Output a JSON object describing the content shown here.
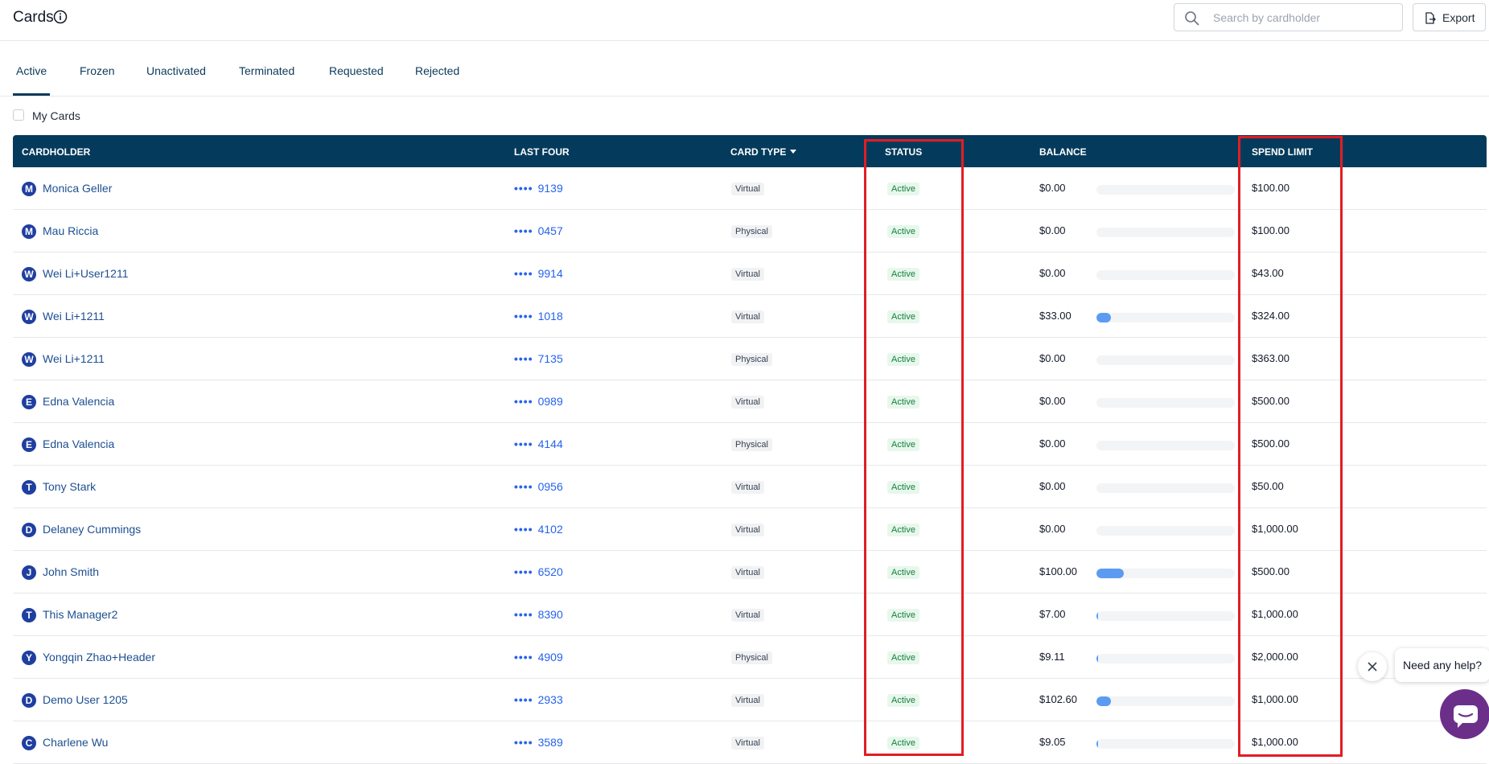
{
  "header": {
    "title": "Cards",
    "search_placeholder": "Search by cardholder",
    "export_label": "Export"
  },
  "tabs": [
    {
      "label": "Active",
      "active": true
    },
    {
      "label": "Frozen"
    },
    {
      "label": "Unactivated"
    },
    {
      "label": "Terminated"
    },
    {
      "label": "Requested"
    },
    {
      "label": "Rejected"
    }
  ],
  "filter": {
    "my_cards_label": "My Cards",
    "my_cards_checked": false
  },
  "table": {
    "columns": {
      "cardholder": "CARDHOLDER",
      "last_four": "LAST FOUR",
      "card_type": "CARD TYPE",
      "status": "STATUS",
      "balance": "BALANCE",
      "spend_limit": "SPEND LIMIT"
    },
    "mask": "••••",
    "rows": [
      {
        "initial": "M",
        "cardholder": "Monica Geller",
        "last_four": "9139",
        "card_type": "Virtual",
        "status": "Active",
        "balance": "$0.00",
        "spend_limit": "$100.00",
        "usage": 0
      },
      {
        "initial": "M",
        "cardholder": "Mau Riccia",
        "last_four": "0457",
        "card_type": "Physical",
        "status": "Active",
        "balance": "$0.00",
        "spend_limit": "$100.00",
        "usage": 0
      },
      {
        "initial": "W",
        "cardholder": "Wei Li+User1211",
        "last_four": "9914",
        "card_type": "Virtual",
        "status": "Active",
        "balance": "$0.00",
        "spend_limit": "$43.00",
        "usage": 0
      },
      {
        "initial": "W",
        "cardholder": "Wei Li+1211",
        "last_four": "1018",
        "card_type": "Virtual",
        "status": "Active",
        "balance": "$33.00",
        "spend_limit": "$324.00",
        "usage": 0.102
      },
      {
        "initial": "W",
        "cardholder": "Wei Li+1211",
        "last_four": "7135",
        "card_type": "Physical",
        "status": "Active",
        "balance": "$0.00",
        "spend_limit": "$363.00",
        "usage": 0
      },
      {
        "initial": "E",
        "cardholder": "Edna Valencia",
        "last_four": "0989",
        "card_type": "Virtual",
        "status": "Active",
        "balance": "$0.00",
        "spend_limit": "$500.00",
        "usage": 0
      },
      {
        "initial": "E",
        "cardholder": "Edna Valencia",
        "last_four": "4144",
        "card_type": "Physical",
        "status": "Active",
        "balance": "$0.00",
        "spend_limit": "$500.00",
        "usage": 0
      },
      {
        "initial": "T",
        "cardholder": "Tony Stark",
        "last_four": "0956",
        "card_type": "Virtual",
        "status": "Active",
        "balance": "$0.00",
        "spend_limit": "$50.00",
        "usage": 0
      },
      {
        "initial": "D",
        "cardholder": "Delaney Cummings",
        "last_four": "4102",
        "card_type": "Virtual",
        "status": "Active",
        "balance": "$0.00",
        "spend_limit": "$1,000.00",
        "usage": 0
      },
      {
        "initial": "J",
        "cardholder": "John Smith",
        "last_four": "6520",
        "card_type": "Virtual",
        "status": "Active",
        "balance": "$100.00",
        "spend_limit": "$500.00",
        "usage": 0.2
      },
      {
        "initial": "T",
        "cardholder": "This Manager2",
        "last_four": "8390",
        "card_type": "Virtual",
        "status": "Active",
        "balance": "$7.00",
        "spend_limit": "$1,000.00",
        "usage": 0.007
      },
      {
        "initial": "Y",
        "cardholder": "Yongqin Zhao+Header",
        "last_four": "4909",
        "card_type": "Physical",
        "status": "Active",
        "balance": "$9.11",
        "spend_limit": "$2,000.00",
        "usage": 0.0046
      },
      {
        "initial": "D",
        "cardholder": "Demo User 1205",
        "last_four": "2933",
        "card_type": "Virtual",
        "status": "Active",
        "balance": "$102.60",
        "spend_limit": "$1,000.00",
        "usage": 0.1026
      },
      {
        "initial": "C",
        "cardholder": "Charlene Wu",
        "last_four": "3589",
        "card_type": "Virtual",
        "status": "Active",
        "balance": "$9.05",
        "spend_limit": "$1,000.00",
        "usage": 0.009
      }
    ]
  },
  "help_widget": {
    "prompt": "Need any help?"
  },
  "colors": {
    "header_bg": "#043b5c",
    "link": "#2563eb",
    "status_green": "#15803d",
    "balance_bar": "#5b9cf2",
    "annotation_red": "#e11d24",
    "chat_purple": "#6b2f8a"
  }
}
